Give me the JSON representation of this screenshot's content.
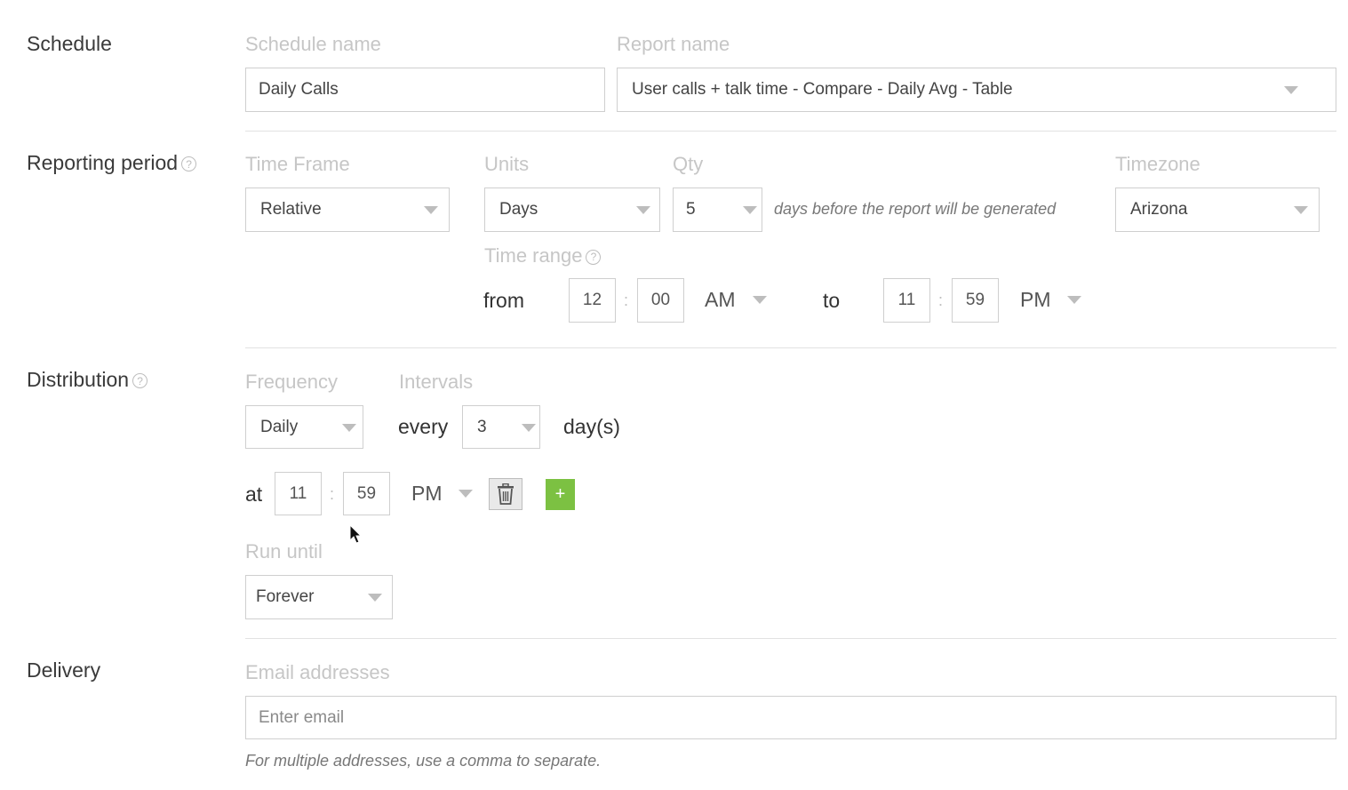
{
  "schedule": {
    "section_title": "Schedule",
    "schedule_name_label": "Schedule name",
    "schedule_name_value": "Daily Calls",
    "report_name_label": "Report name",
    "report_name_value": "User calls + talk time - Compare - Daily Avg - Table"
  },
  "reporting_period": {
    "section_title": "Reporting period",
    "time_frame_label": "Time Frame",
    "time_frame_value": "Relative",
    "units_label": "Units",
    "units_value": "Days",
    "qty_label": "Qty",
    "qty_value": "5",
    "qty_hint": "days before the report will be generated",
    "timezone_label": "Timezone",
    "timezone_value": "Arizona",
    "time_range_label": "Time range",
    "from_label": "from",
    "from_hour": "12",
    "from_minute": "00",
    "from_ampm": "AM",
    "to_label": "to",
    "to_hour": "11",
    "to_minute": "59",
    "to_ampm": "PM"
  },
  "distribution": {
    "section_title": "Distribution",
    "frequency_label": "Frequency",
    "frequency_value": "Daily",
    "intervals_label": "Intervals",
    "every_label": "every",
    "interval_value": "3",
    "interval_unit": "day(s)",
    "at_label": "at",
    "at_hour": "11",
    "at_minute": "59",
    "at_ampm": "PM",
    "add_symbol": "+",
    "run_until_label": "Run until",
    "run_until_value": "Forever"
  },
  "delivery": {
    "section_title": "Delivery",
    "email_label": "Email addresses",
    "email_placeholder": "Enter email",
    "email_hint": "For multiple addresses, use a comma to separate."
  },
  "icons": {
    "help": "?",
    "help_icon_name": "question-circle-icon",
    "delete_icon_name": "trash-icon",
    "add_icon_name": "plus-icon",
    "accent_green": "#7cc142"
  }
}
